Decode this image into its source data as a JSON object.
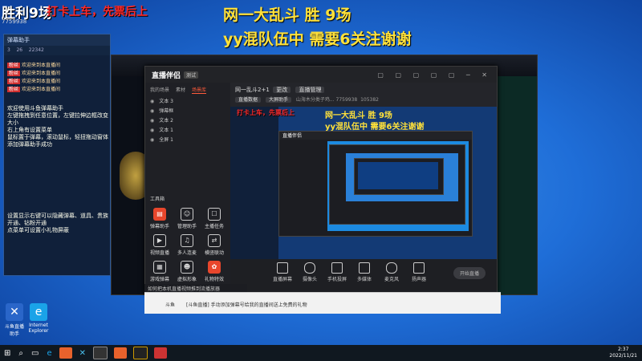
{
  "overlay": {
    "top_left_red": "打卡上车，先票后上",
    "top_left_white": "胜利9场",
    "line1": "网一大乱斗 胜 9场",
    "line2": "yy混队伍中 需要6关注谢谢",
    "streamer_id": "7759938"
  },
  "chat": {
    "title": "弹幕助手",
    "stats": [
      "3",
      "26",
      "22342"
    ],
    "welcome_msgs": [
      {
        "tag": "粉丝",
        "text": "欢迎来到本直播间"
      },
      {
        "tag": "粉丝",
        "text": "欢迎来到本直播间"
      },
      {
        "tag": "粉丝",
        "text": "欢迎来到本直播间"
      },
      {
        "tag": "粉丝",
        "text": "欢迎来到本直播间"
      }
    ],
    "system_lines": [
      "欢迎使用斗鱼弹幕助手",
      "左键拖拽到任意位置，左键拉伸边框改变大小",
      "右上角有设置菜单",
      "鼠标置于弹幕，滚动鼠标，轻扭拖动窗体",
      "添加弹幕助手成功"
    ],
    "bottom_lines": [
      "设置显示右键可以隐藏弹幕、道具、贵族开通、钻粉开通",
      "点菜单可设置小礼物屏蔽"
    ]
  },
  "recorder": {
    "logo": "直播伴侣",
    "badge": "测试",
    "tabs": [
      "我的场景",
      "素材",
      "场景库"
    ],
    "active_tab": "场景库",
    "scenes": [
      "文本 3",
      "弹幕框",
      "文本 2",
      "文本 1",
      "全屏 1"
    ],
    "tools_title": "工具箱",
    "tools": [
      {
        "label": "弹幕助手",
        "icon": "danmaku-icon",
        "red": true
      },
      {
        "label": "管理助手",
        "icon": "manager-icon",
        "red": false
      },
      {
        "label": "主播任务",
        "icon": "task-icon",
        "red": false
      },
      {
        "label": "视频直播",
        "icon": "video-icon",
        "red": false
      },
      {
        "label": "多人连麦",
        "icon": "multi-mic-icon",
        "red": false
      },
      {
        "label": "横竖联动",
        "icon": "link-icon",
        "red": false
      },
      {
        "label": "游戏弹幕",
        "icon": "game-danmaku-icon",
        "red": false
      },
      {
        "label": "虚拟形象",
        "icon": "avatar-icon",
        "red": false
      },
      {
        "label": "礼物特效",
        "icon": "gift-icon",
        "red": true
      }
    ],
    "header_title": "网一乱斗2+1",
    "header_btns": [
      "更改",
      "直播管理"
    ],
    "header_sub": [
      "直播数据",
      "大屏助手"
    ],
    "room_info": "山海木分类子鸡... 7759938",
    "fans": "105382",
    "bottom_tools": [
      {
        "label": "直播屏幕",
        "icon": "screen-icon"
      },
      {
        "label": "摄像头",
        "icon": "camera-icon"
      },
      {
        "label": "手机投屏",
        "icon": "phone-icon"
      },
      {
        "label": "多媒体",
        "icon": "media-icon"
      },
      {
        "label": "麦克风",
        "icon": "mic-icon"
      },
      {
        "label": "扬声器",
        "icon": "speaker-icon"
      }
    ],
    "start_label": "开始直播",
    "hint": "如何把本机直播视频推到流播放器"
  },
  "browser": {
    "title": "斗鱼",
    "text": "[斗鱼直播] 手动添加弹幕号给我的直播间送上免费的礼物"
  },
  "desktop_icons": [
    "斗鱼直播助手",
    "Internet Explorer"
  ],
  "taskbar": {
    "time": "2:37",
    "date": "2022/11/21"
  },
  "colors": {
    "accent": "#ff5a3a",
    "overlay_yellow": "#ffe13a",
    "overlay_red": "#ff2a2a",
    "desktop_blue": "#1f6ed8"
  }
}
